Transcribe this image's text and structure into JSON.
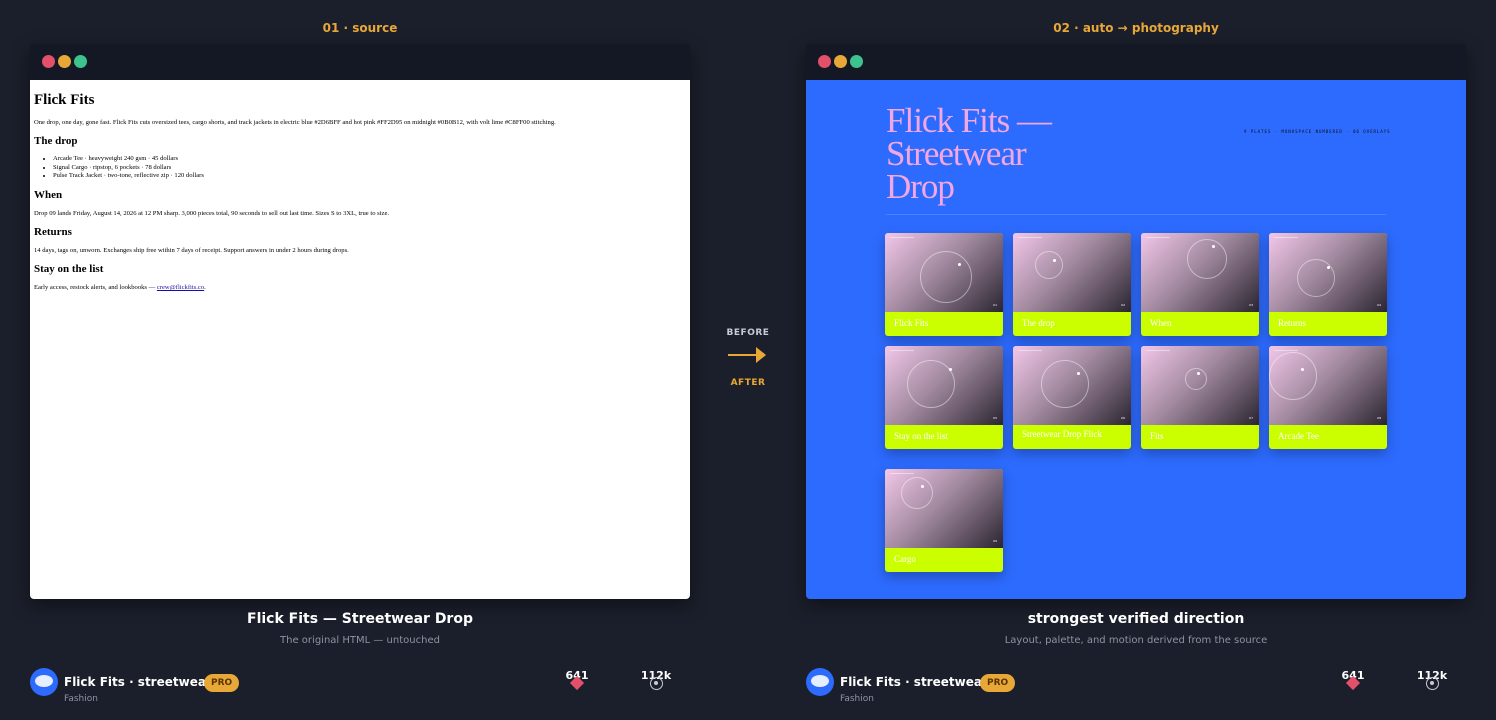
{
  "left": {
    "column_label": "01 · source",
    "doc": {
      "h1": "Flick Fits",
      "intro": "One drop, one day, gone fast. Flick Fits cuts oversized tees, cargo shorts, and track jackets in electric blue #2D6BFF and hot pink #FF2D95 on midnight #0B0B12, with volt lime #C8FF00 stitching.",
      "drop_heading": "The drop",
      "items": [
        "Arcade Tee · heavyweight 240 gsm · 45 dollars",
        "Signal Cargo · ripstop, 6 pockets · 78 dollars",
        "Pulse Track Jacket · two-tone, reflective zip · 120 dollars"
      ],
      "when_heading": "When",
      "when_text": "Drop 09 lands Friday, August 14, 2026 at 12 PM sharp. 3,000 pieces total, 90 seconds to sell out last time. Sizes S to 3XL, true to size.",
      "returns_heading": "Returns",
      "returns_text": "14 days, tags on, unworn. Exchanges ship free within 7 days of receipt. Support answers in under 2 hours during drops.",
      "list_heading": "Stay on the list",
      "list_text": "Early access, restock alerts, and lookbooks — ",
      "email": "crew@flickfits.co",
      "after_email": "."
    },
    "caption_title": "Flick Fits — Streetwear Drop",
    "caption_sub": "The original HTML — untouched"
  },
  "right": {
    "column_label": "02 · auto → photography",
    "title_lines": [
      "Flick Fits —",
      "Streetwear",
      "Drop"
    ],
    "meta": "9 PLATES · MONOSPACE NUMBERED · 06 OVERLAYS",
    "cards": [
      {
        "label": "Flick Fits"
      },
      {
        "label": "The drop"
      },
      {
        "label": "When"
      },
      {
        "label": "Returns"
      },
      {
        "label": "Stay on the list"
      },
      {
        "label": "Streetwear Drop Flick"
      },
      {
        "label": "Fits"
      },
      {
        "label": "Arcade Tee"
      },
      {
        "label": "Cargo"
      }
    ],
    "caption_title": "strongest verified direction",
    "caption_sub": "Layout, palette, and motion derived from the source"
  },
  "transition": {
    "before": "BEFORE",
    "after": "AFTER"
  },
  "footer": {
    "author": "Flick Fits · streetwear",
    "badge": "PRO",
    "category": "Fashion",
    "likes": "641",
    "views": "112k"
  },
  "colors": {
    "background": "#1b1f2b",
    "accent": "#e8a838",
    "brand_blue": "#2d6bff",
    "hot_pink": "#f3a6e0",
    "volt_lime": "#cbff00",
    "heart": "#e2506a"
  }
}
